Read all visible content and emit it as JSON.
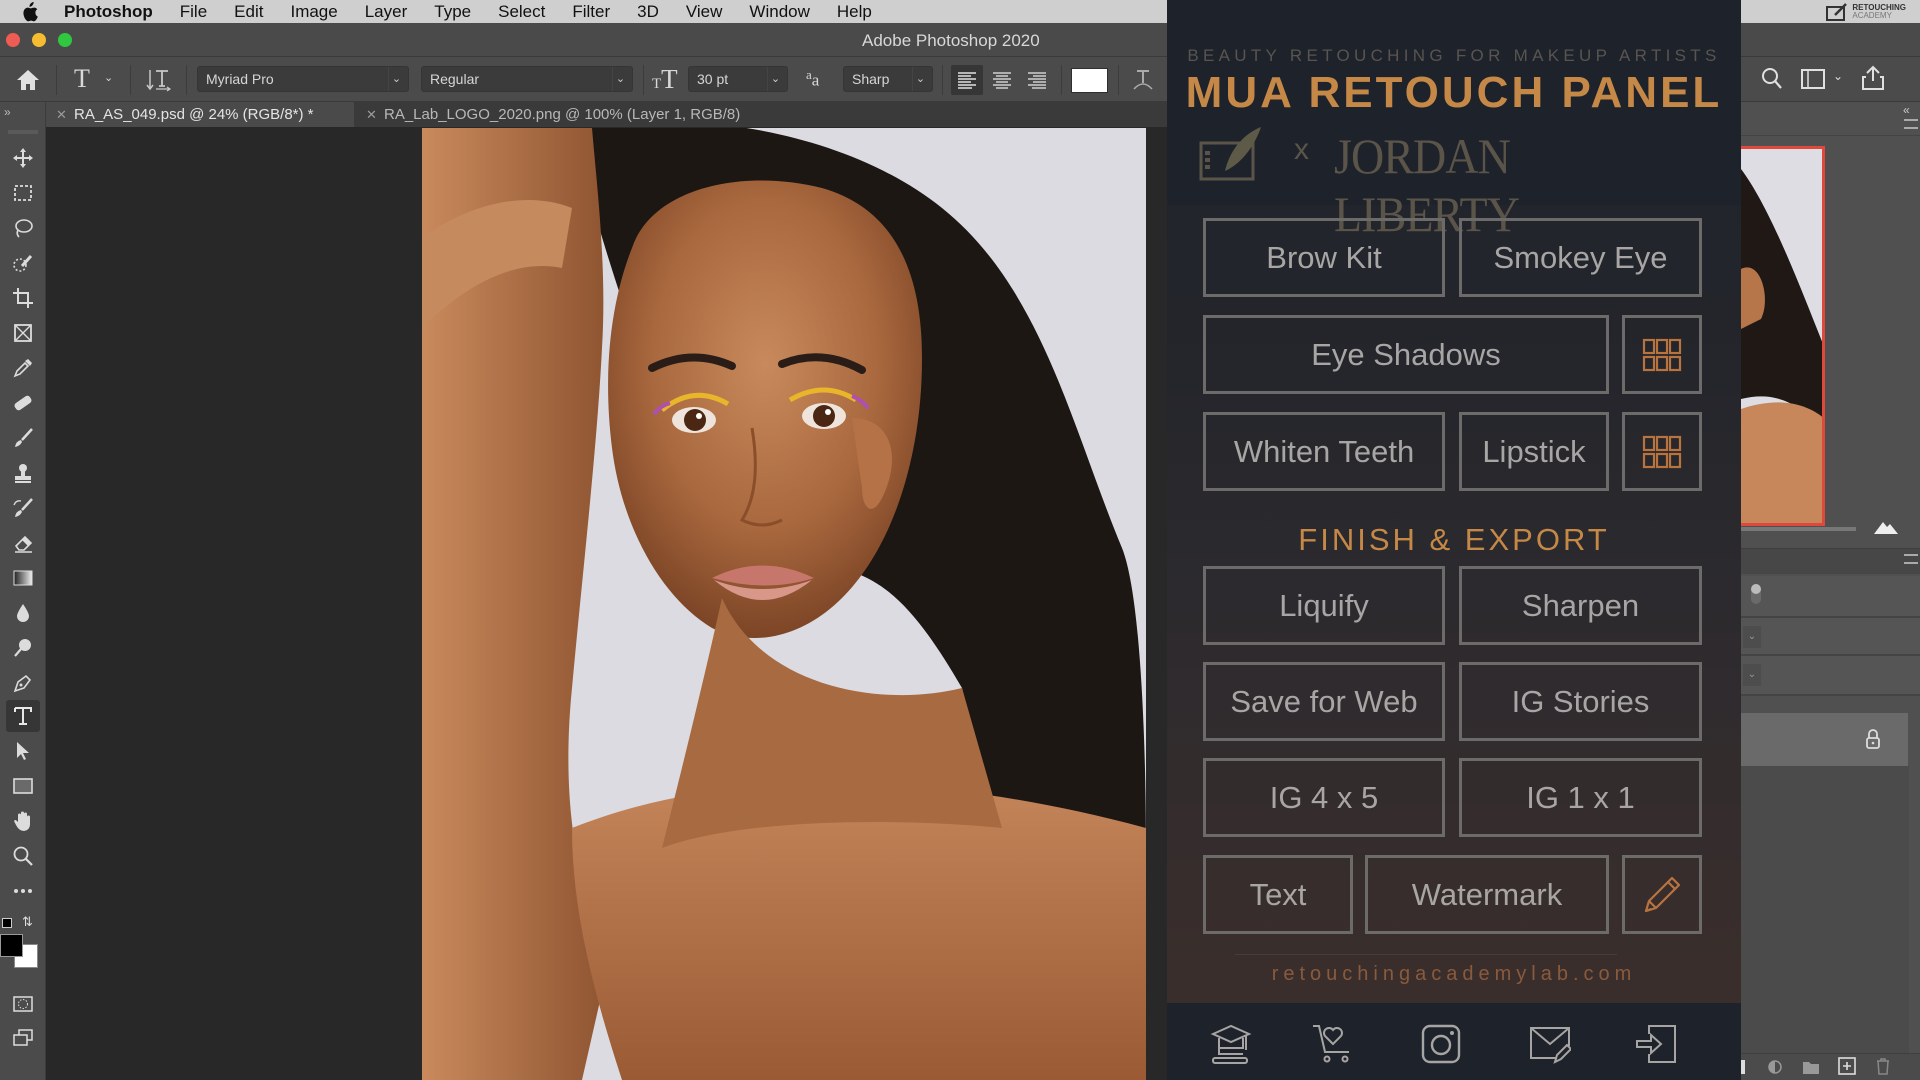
{
  "menubar": {
    "app_name": "Photoshop",
    "items": [
      "File",
      "Edit",
      "Image",
      "Layer",
      "Type",
      "Select",
      "Filter",
      "3D",
      "View",
      "Window",
      "Help"
    ],
    "brand_logo_line1": "RETOUCHING",
    "brand_logo_line2": "ACADEMY"
  },
  "window": {
    "title": "Adobe Photoshop 2020",
    "traffic_lights": {
      "close": "#ee5c54",
      "minimize": "#f5bd2f",
      "maximize": "#2fc840"
    }
  },
  "options_bar": {
    "tool_icon": "type-tool-icon",
    "font_family": "Myriad Pro",
    "font_style": "Regular",
    "font_size": "30 pt",
    "anti_alias": "Sharp",
    "alignments": [
      "align-left",
      "align-center",
      "align-right"
    ],
    "active_alignment": "align-left",
    "text_color": "#ffffff"
  },
  "tabs": [
    {
      "label": "RA_AS_049.psd @ 24% (RGB/8*) *",
      "active": true
    },
    {
      "label": "RA_Lab_LOGO_2020.png @ 100% (Layer 1, RGB/8)",
      "active": false
    }
  ],
  "toolbar": {
    "tools": [
      "move",
      "rectangular-marquee",
      "lasso",
      "quick-selection",
      "crop",
      "frame",
      "eyedropper",
      "healing-brush",
      "brush",
      "clone-stamp",
      "history-brush",
      "eraser",
      "gradient",
      "blur",
      "dodge",
      "pen",
      "type",
      "path-selection",
      "rectangle",
      "hand",
      "zoom",
      "edit-toolbar"
    ],
    "active_tool": "type",
    "foreground_color": "#000000",
    "background_color": "#ffffff"
  },
  "panel": {
    "subtitle": "BEAUTY RETOUCHING FOR MAKEUP ARTISTS",
    "title": "MUA RETOUCH PANEL",
    "collab_x": "x",
    "collab_name": "JORDAN LIBERTY",
    "accent_color": "#c58847",
    "buttons_retouch": {
      "brow_kit": "Brow Kit",
      "smokey_eye": "Smokey Eye",
      "eye_shadows": "Eye Shadows",
      "whiten_teeth": "Whiten Teeth",
      "lipstick": "Lipstick"
    },
    "section_finish": "FINISH & EXPORT",
    "buttons_finish": {
      "liquify": "Liquify",
      "sharpen": "Sharpen",
      "save_for_web": "Save for Web",
      "ig_stories": "IG Stories",
      "ig_4x5": "IG 4 x 5",
      "ig_1x1": "IG 1 x 1",
      "text": "Text",
      "watermark": "Watermark"
    },
    "url": "retouchingacademylab.com",
    "footer_icons": [
      "graduation-cap-icon",
      "cart-heart-icon",
      "instagram-icon",
      "mail-edit-icon",
      "sign-in-icon"
    ]
  }
}
